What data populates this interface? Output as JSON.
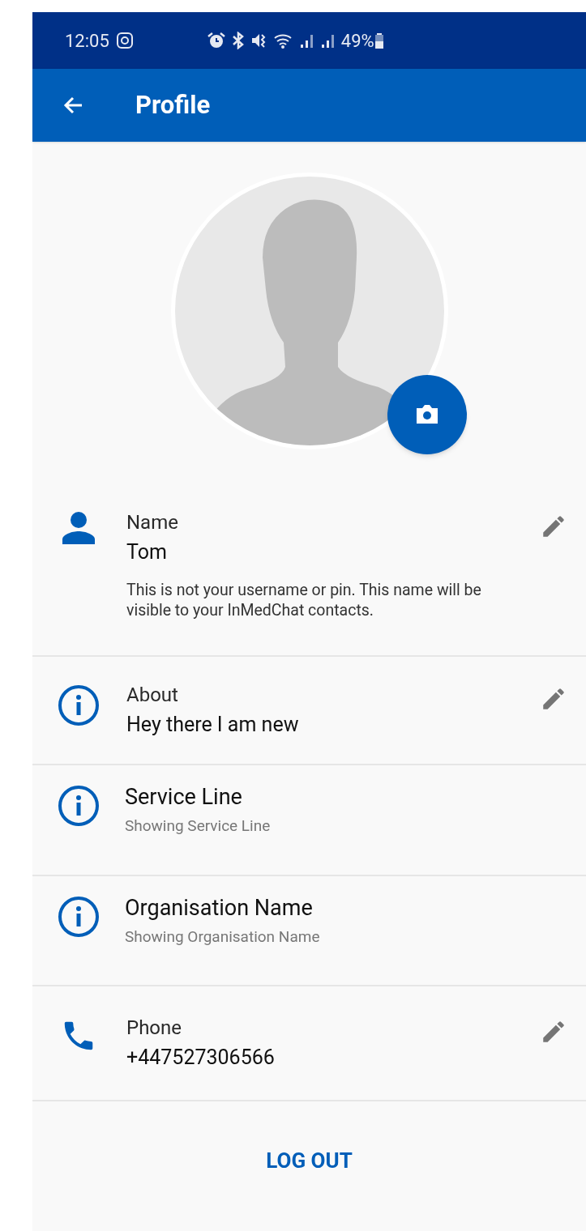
{
  "status_bar": {
    "time": "12:05",
    "battery_percent": "49%"
  },
  "app_bar": {
    "title": "Profile"
  },
  "rows": [
    {
      "kind": "person",
      "label": "Name",
      "value": "Tom",
      "note": "This is not your username or pin. This name will be visible to your InMedChat contacts.",
      "editable": true
    },
    {
      "kind": "info",
      "label": "About",
      "value": "Hey there I am new",
      "editable": true
    },
    {
      "kind": "info",
      "title": "Service Line",
      "subtitle": "Showing Service Line",
      "editable": false
    },
    {
      "kind": "info",
      "title": "Organisation Name",
      "subtitle": "Showing Organisation Name",
      "editable": false
    },
    {
      "kind": "phone",
      "label": "Phone",
      "value": "+447527306566",
      "editable": true
    }
  ],
  "logout_button": "LOG OUT"
}
